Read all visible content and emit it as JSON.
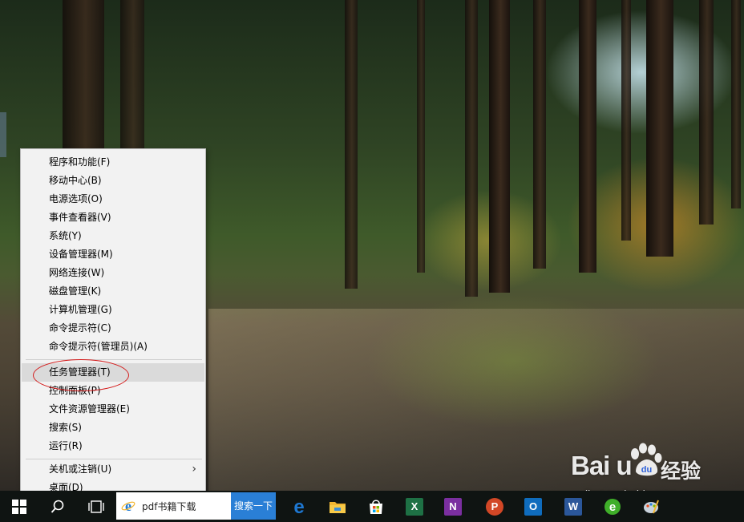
{
  "menu": {
    "items": [
      {
        "label": "程序和功能(F)"
      },
      {
        "label": "移动中心(B)"
      },
      {
        "label": "电源选项(O)"
      },
      {
        "label": "事件查看器(V)"
      },
      {
        "label": "系统(Y)"
      },
      {
        "label": "设备管理器(M)"
      },
      {
        "label": "网络连接(W)"
      },
      {
        "label": "磁盘管理(K)"
      },
      {
        "label": "计算机管理(G)"
      },
      {
        "label": "命令提示符(C)"
      },
      {
        "label": "命令提示符(管理员)(A)"
      },
      {
        "label": "任务管理器(T)",
        "highlighted": true
      },
      {
        "label": "控制面板(P)"
      },
      {
        "label": "文件资源管理器(E)"
      },
      {
        "label": "搜索(S)"
      },
      {
        "label": "运行(R)"
      },
      {
        "label": "关机或注销(U)",
        "submenu": true
      },
      {
        "label": "桌面(D)"
      }
    ],
    "submenu_arrow": "›"
  },
  "taskbar": {
    "search_text": "pdf书籍下载",
    "search_button": "搜索一下",
    "apps": [
      {
        "name": "edge",
        "glyph": "e",
        "color": "#1e78d2"
      },
      {
        "name": "file-explorer",
        "glyph": "",
        "color": "#f2b632"
      },
      {
        "name": "store",
        "glyph": "",
        "color": "#ffffff"
      },
      {
        "name": "excel",
        "glyph": "X",
        "color": "#1e7145"
      },
      {
        "name": "onenote",
        "glyph": "N",
        "color": "#7b2fa0"
      },
      {
        "name": "powerpoint",
        "glyph": "P",
        "color": "#d24726"
      },
      {
        "name": "outlook",
        "glyph": "O",
        "color": "#0f6cbd"
      },
      {
        "name": "word",
        "glyph": "W",
        "color": "#2b579a"
      },
      {
        "name": "browser-360",
        "glyph": "e",
        "color": "#3fae29"
      },
      {
        "name": "paint-app",
        "glyph": "",
        "color": "#9aa7b5"
      }
    ]
  },
  "watermark": {
    "logo": "Bai  u",
    "logo_du": "du",
    "cn": "经验",
    "url": "jingyan.baidu.com"
  },
  "colors": {
    "menu_bg": "#f2f2f2",
    "menu_highlight": "#dadada",
    "annotation": "#d41a1a",
    "taskbar_bg": "#0f1412",
    "search_button_bg": "#2a7fd6"
  }
}
